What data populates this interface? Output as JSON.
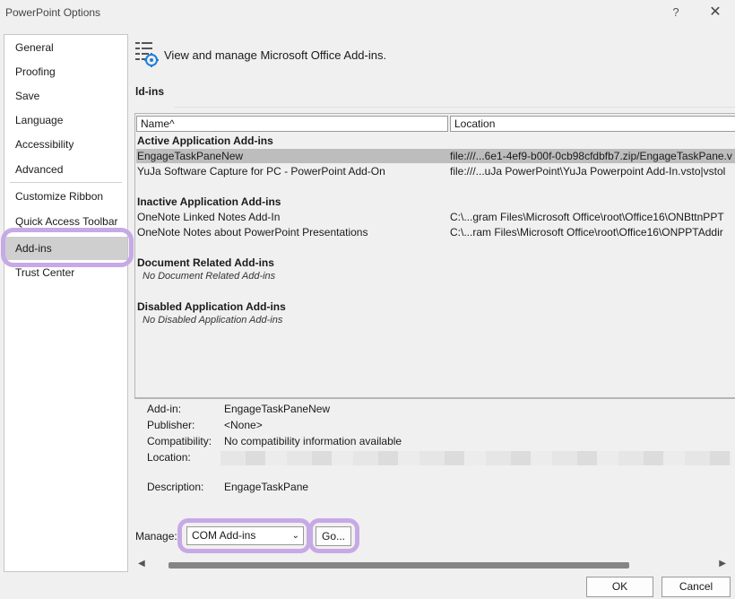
{
  "window": {
    "title": "PowerPoint Options",
    "help_glyph": "?",
    "close_glyph": "✕"
  },
  "sidebar": {
    "items": [
      {
        "label": "General"
      },
      {
        "label": "Proofing"
      },
      {
        "label": "Save"
      },
      {
        "label": "Language"
      },
      {
        "label": "Accessibility"
      },
      {
        "label": "Advanced"
      },
      {
        "label": "Customize Ribbon"
      },
      {
        "label": "Quick Access Toolbar"
      },
      {
        "label": "Add-ins"
      },
      {
        "label": "Trust Center"
      }
    ],
    "selected": "Add-ins"
  },
  "header": {
    "text": "View and manage Microsoft Office Add-ins."
  },
  "section": {
    "label": "ld-ins"
  },
  "list": {
    "columns": [
      "Name^",
      "Location"
    ],
    "groups": [
      {
        "title": "Active Application Add-ins",
        "rows": [
          {
            "name": "EngageTaskPaneNew",
            "location": "file:///...6e1-4ef9-b00f-0cb98cfdbfb7.zip/EngageTaskPane.v"
          },
          {
            "name": "YuJa Software Capture for PC - PowerPoint Add-On",
            "location": "file:///...uJa PowerPoint\\YuJa Powerpoint Add-In.vsto|vstol"
          }
        ]
      },
      {
        "title": "Inactive Application Add-ins",
        "rows": [
          {
            "name": "OneNote Linked Notes Add-In",
            "location": "C:\\...gram Files\\Microsoft Office\\root\\Office16\\ONBttnPPT"
          },
          {
            "name": "OneNote Notes about PowerPoint Presentations",
            "location": "C:\\...ram Files\\Microsoft Office\\root\\Office16\\ONPPTAddir"
          }
        ]
      },
      {
        "title": "Document Related Add-ins",
        "empty": "No Document Related Add-ins"
      },
      {
        "title": "Disabled Application Add-ins",
        "empty": "No Disabled Application Add-ins"
      }
    ]
  },
  "details": {
    "addin_label": "Add-in:",
    "addin_value": "EngageTaskPaneNew",
    "publisher_label": "Publisher:",
    "publisher_value": "<None>",
    "compat_label": "Compatibility:",
    "compat_value": "No compatibility information available",
    "location_label": "Location:",
    "desc_label": "Description:",
    "desc_value": "EngageTaskPane"
  },
  "manage": {
    "label": "Manage:",
    "selected": "COM Add-ins",
    "go_label": "Go..."
  },
  "scroll": {
    "left_arrow": "◀",
    "right_arrow": "▶"
  },
  "buttons": {
    "ok": "OK",
    "cancel": "Cancel"
  },
  "colors": {
    "highlight": "#c7a9e6",
    "selected_nav": "#cfcfcf",
    "selected_row": "#bdbdbd"
  }
}
